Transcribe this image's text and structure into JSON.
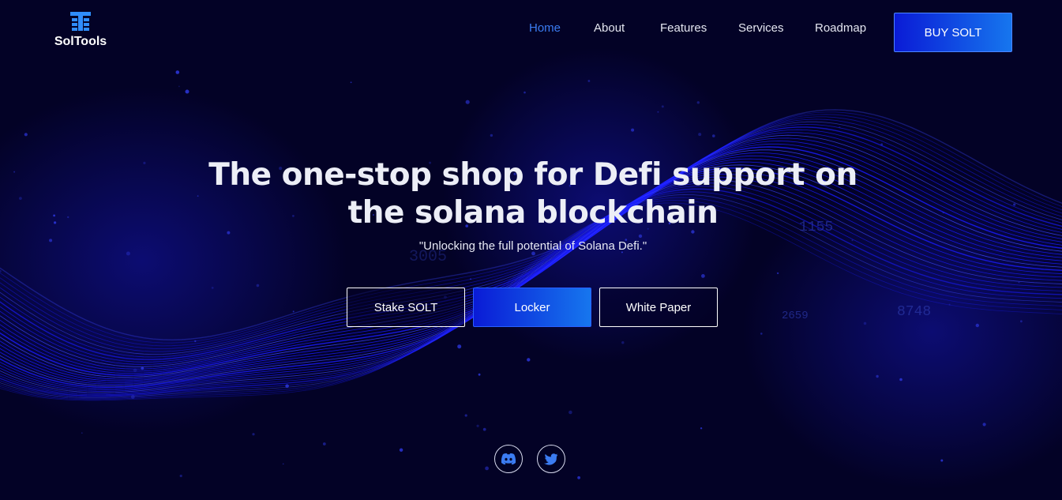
{
  "brand": {
    "name": "SolTools"
  },
  "nav": {
    "items": [
      {
        "label": "Home",
        "active": true
      },
      {
        "label": "About",
        "active": false
      },
      {
        "label": "Features",
        "active": false
      },
      {
        "label": "Services",
        "active": false
      },
      {
        "label": "Roadmap",
        "active": false
      }
    ],
    "buy_label": "BUY SOLT"
  },
  "hero": {
    "title_line1": "The one-stop shop for Defi support on",
    "title_line2": "the solana blockchain",
    "subtitle": "\"Unlocking the full potential of Solana Defi.\"",
    "buttons": {
      "stake": "Stake SOLT",
      "locker": "Locker",
      "whitepaper": "White Paper"
    }
  },
  "background_numbers": [
    "1155",
    "8748",
    "2659",
    "3005"
  ],
  "social": [
    {
      "icon": "discord-icon"
    },
    {
      "icon": "twitter-icon"
    }
  ],
  "colors": {
    "background": "#030226",
    "accent": "#3b7cf2",
    "wave": "#1a1cff",
    "button_gradient_start": "#0a1bd6",
    "button_gradient_end": "#1676ee"
  }
}
